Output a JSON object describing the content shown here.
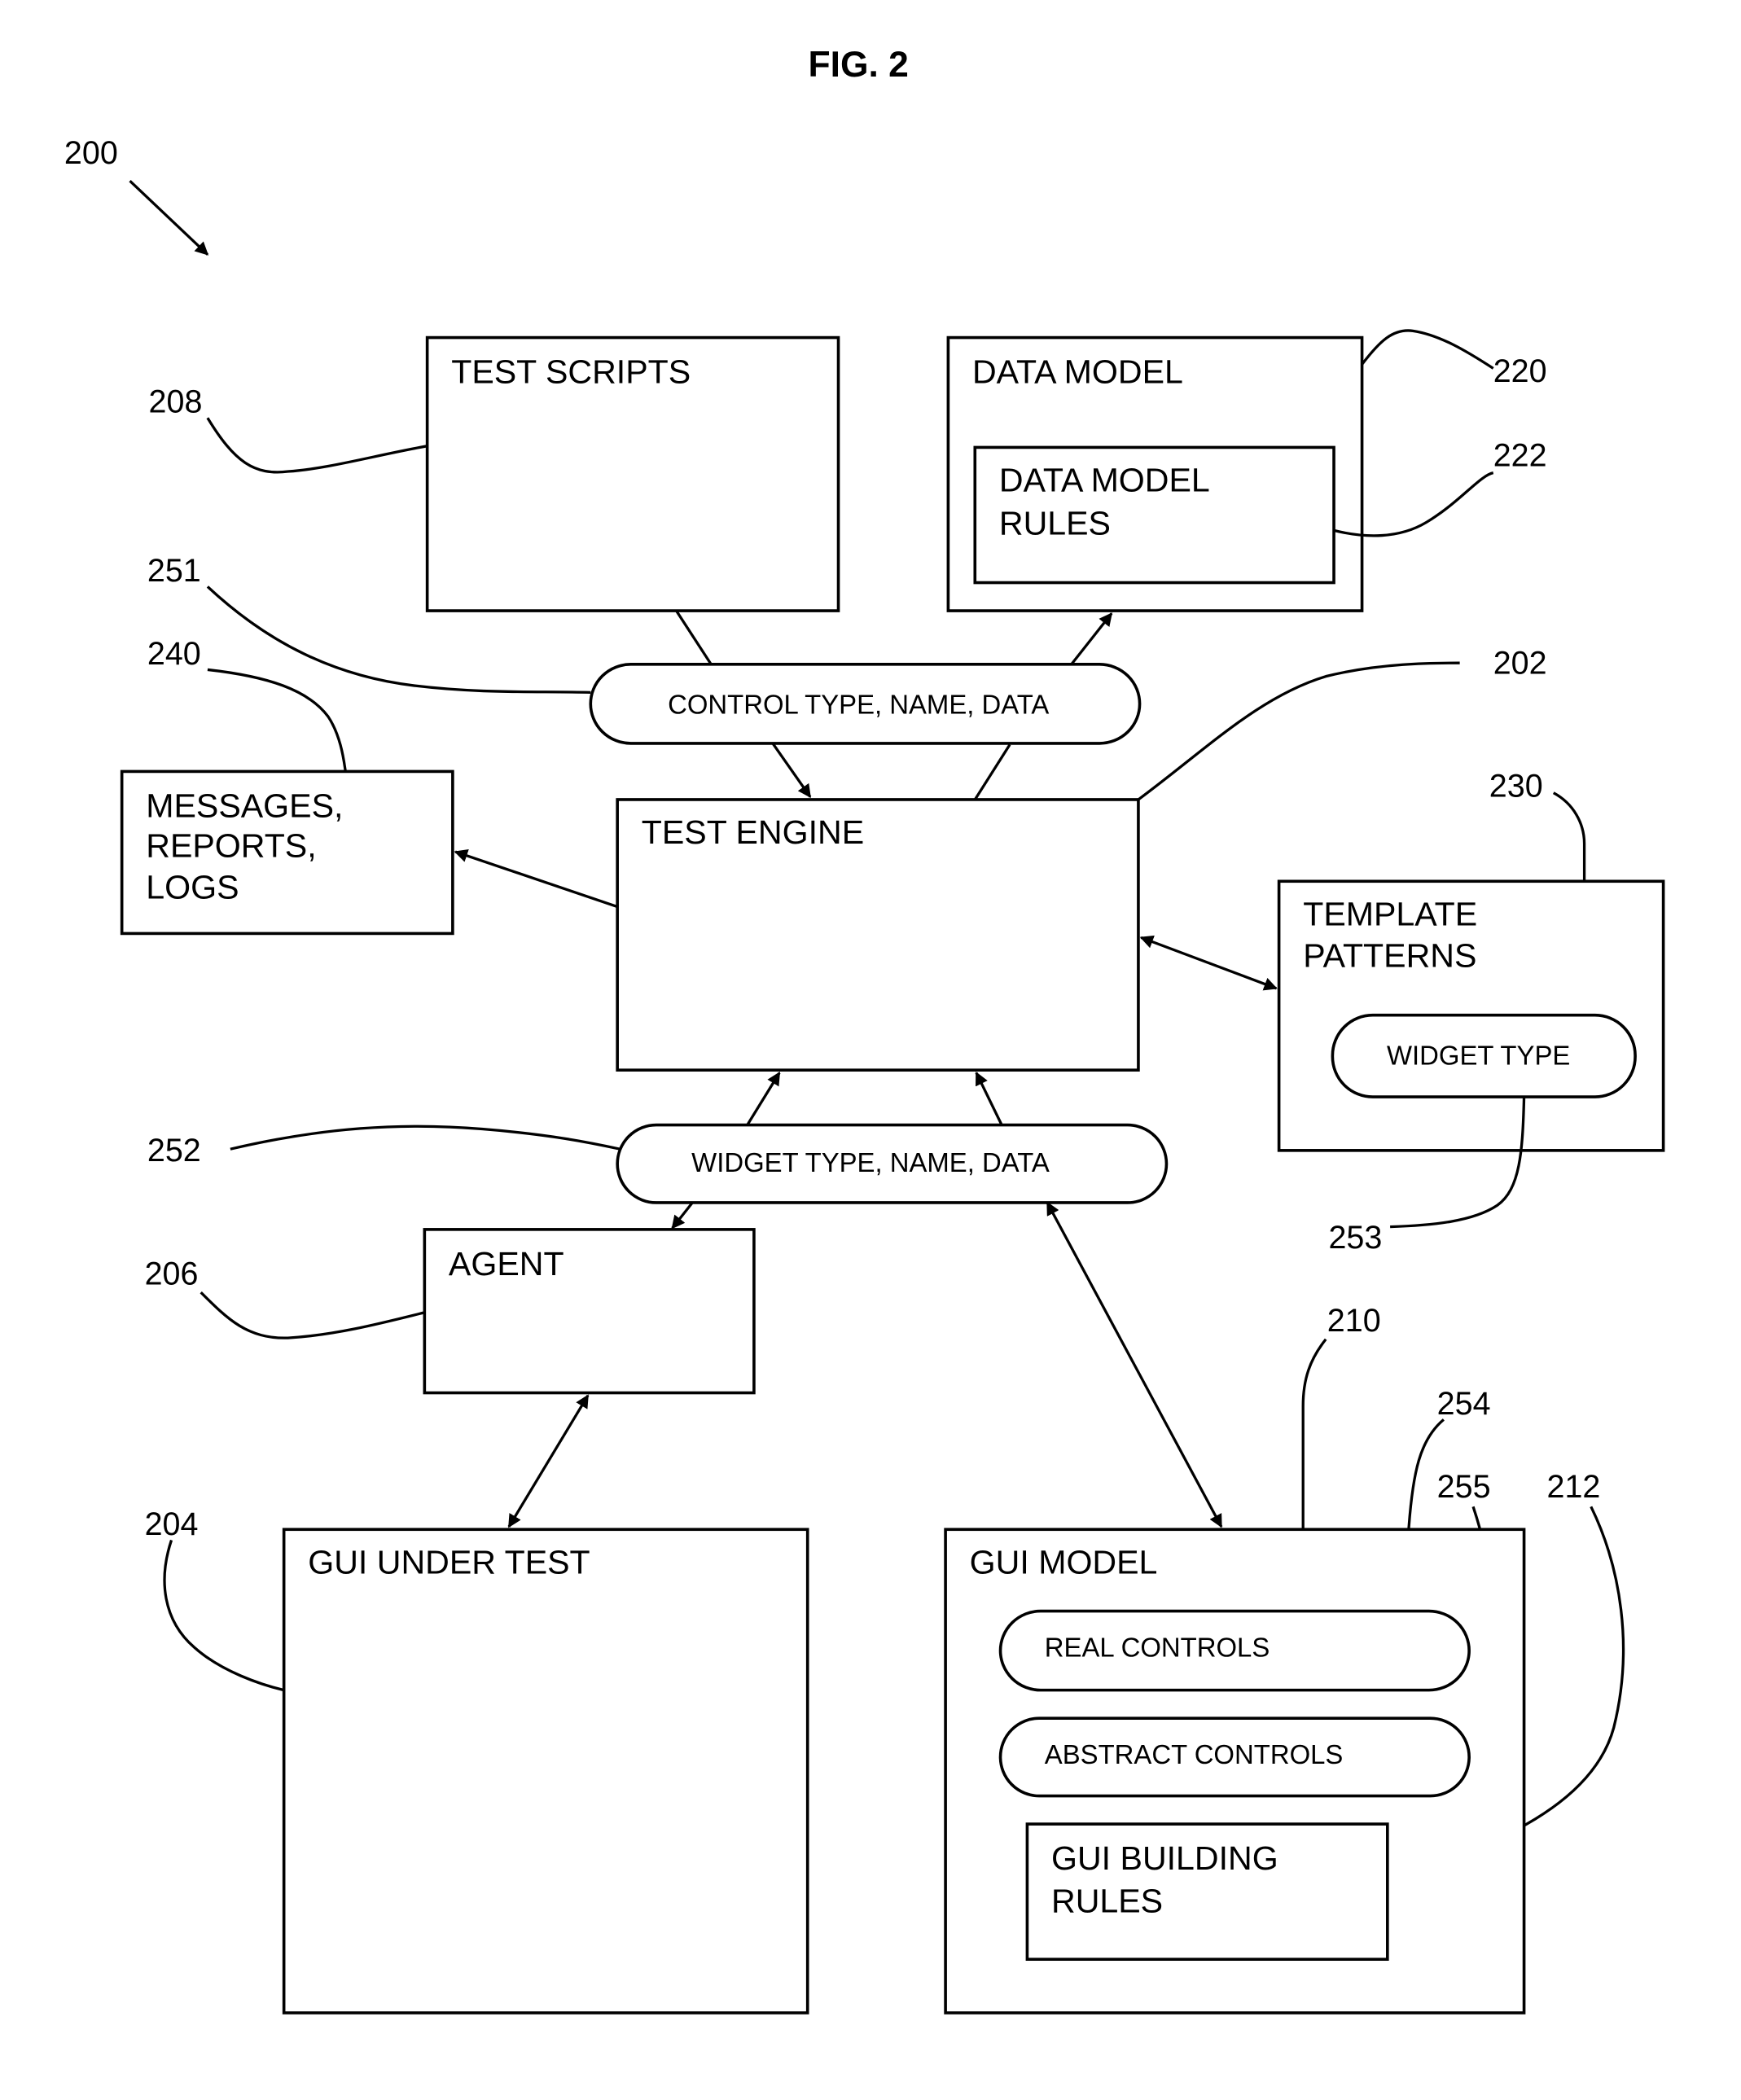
{
  "figure": {
    "title": "FIG. 2",
    "ref": "200"
  },
  "boxes": {
    "test_scripts": {
      "label": "TEST SCRIPTS",
      "ref": "208"
    },
    "data_model": {
      "label": "DATA MODEL",
      "ref": "220"
    },
    "data_model_rules": {
      "line1": "DATA MODEL",
      "line2": "RULES",
      "ref": "222"
    },
    "messages": {
      "line1": "MESSAGES,",
      "line2": "REPORTS,",
      "line3": "LOGS",
      "ref": "240"
    },
    "test_engine": {
      "label": "TEST ENGINE",
      "ref": "202"
    },
    "template_patterns": {
      "line1": "TEMPLATE",
      "line2": "PATTERNS",
      "ref": "230"
    },
    "agent": {
      "label": "AGENT",
      "ref": "206"
    },
    "gui_under_test": {
      "label": "GUI UNDER TEST",
      "ref": "204"
    },
    "gui_model": {
      "label": "GUI MODEL",
      "ref": "210"
    },
    "gui_building_rules": {
      "line1": "GUI BUILDING",
      "line2": "RULES",
      "ref": "212"
    }
  },
  "ovals": {
    "control": {
      "label": "CONTROL TYPE, NAME, DATA",
      "ref": "251"
    },
    "widget": {
      "label": "WIDGET TYPE, NAME, DATA",
      "ref": "252"
    },
    "widget_type": {
      "label": "WIDGET  TYPE",
      "ref": "253"
    },
    "real_controls": {
      "label": "REAL CONTROLS",
      "ref": "254"
    },
    "abstract_controls": {
      "label": "ABSTRACT CONTROLS",
      "ref": "255"
    }
  }
}
